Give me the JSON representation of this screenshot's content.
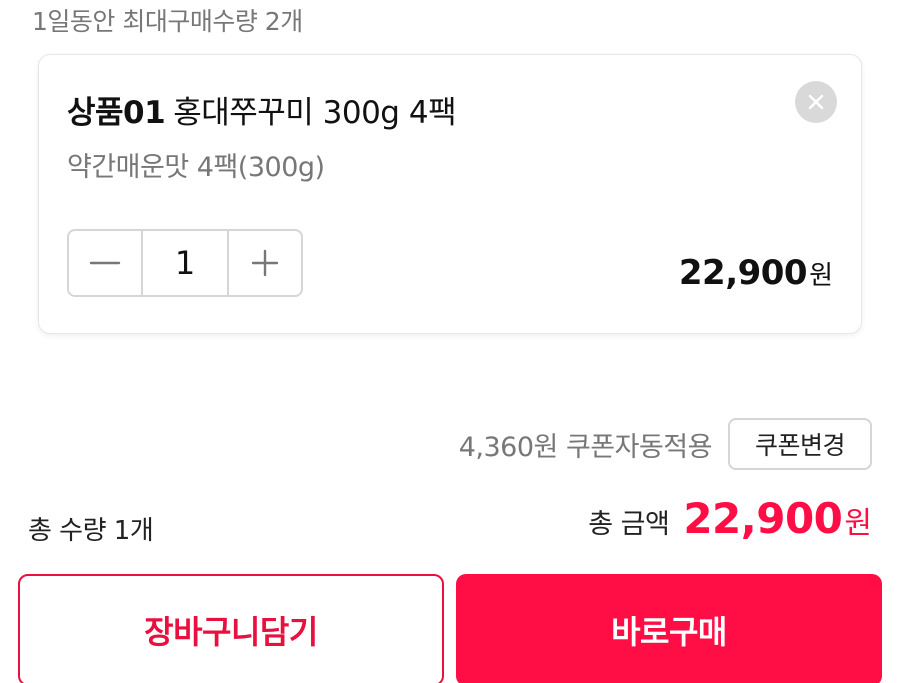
{
  "purchase_limit": {
    "text": "1일동안 최대구매수량 2개"
  },
  "item": {
    "code": "상품01",
    "name": "홍대쭈꾸미 300g 4팩",
    "option": "약간매운맛 4팩(300g)",
    "quantity": "1",
    "price": "22,900",
    "price_unit": "원",
    "remove_icon": "close-icon",
    "decrement_icon": "minus-icon",
    "increment_icon": "plus-icon"
  },
  "coupon": {
    "applied_text": "4,360원 쿠폰자동적용",
    "change_label": "쿠폰변경"
  },
  "summary": {
    "total_quantity_text": "총 수량 1개",
    "total_amount_label": "총 금액",
    "total_amount": "22,900",
    "total_amount_unit": "원"
  },
  "actions": {
    "cart_label": "장바구니담기",
    "buy_label": "바로구매"
  },
  "colors": {
    "accent": "#ff0d45",
    "outline_accent": "#e8103f",
    "muted_text": "#777777",
    "border": "#d6d6d6"
  }
}
